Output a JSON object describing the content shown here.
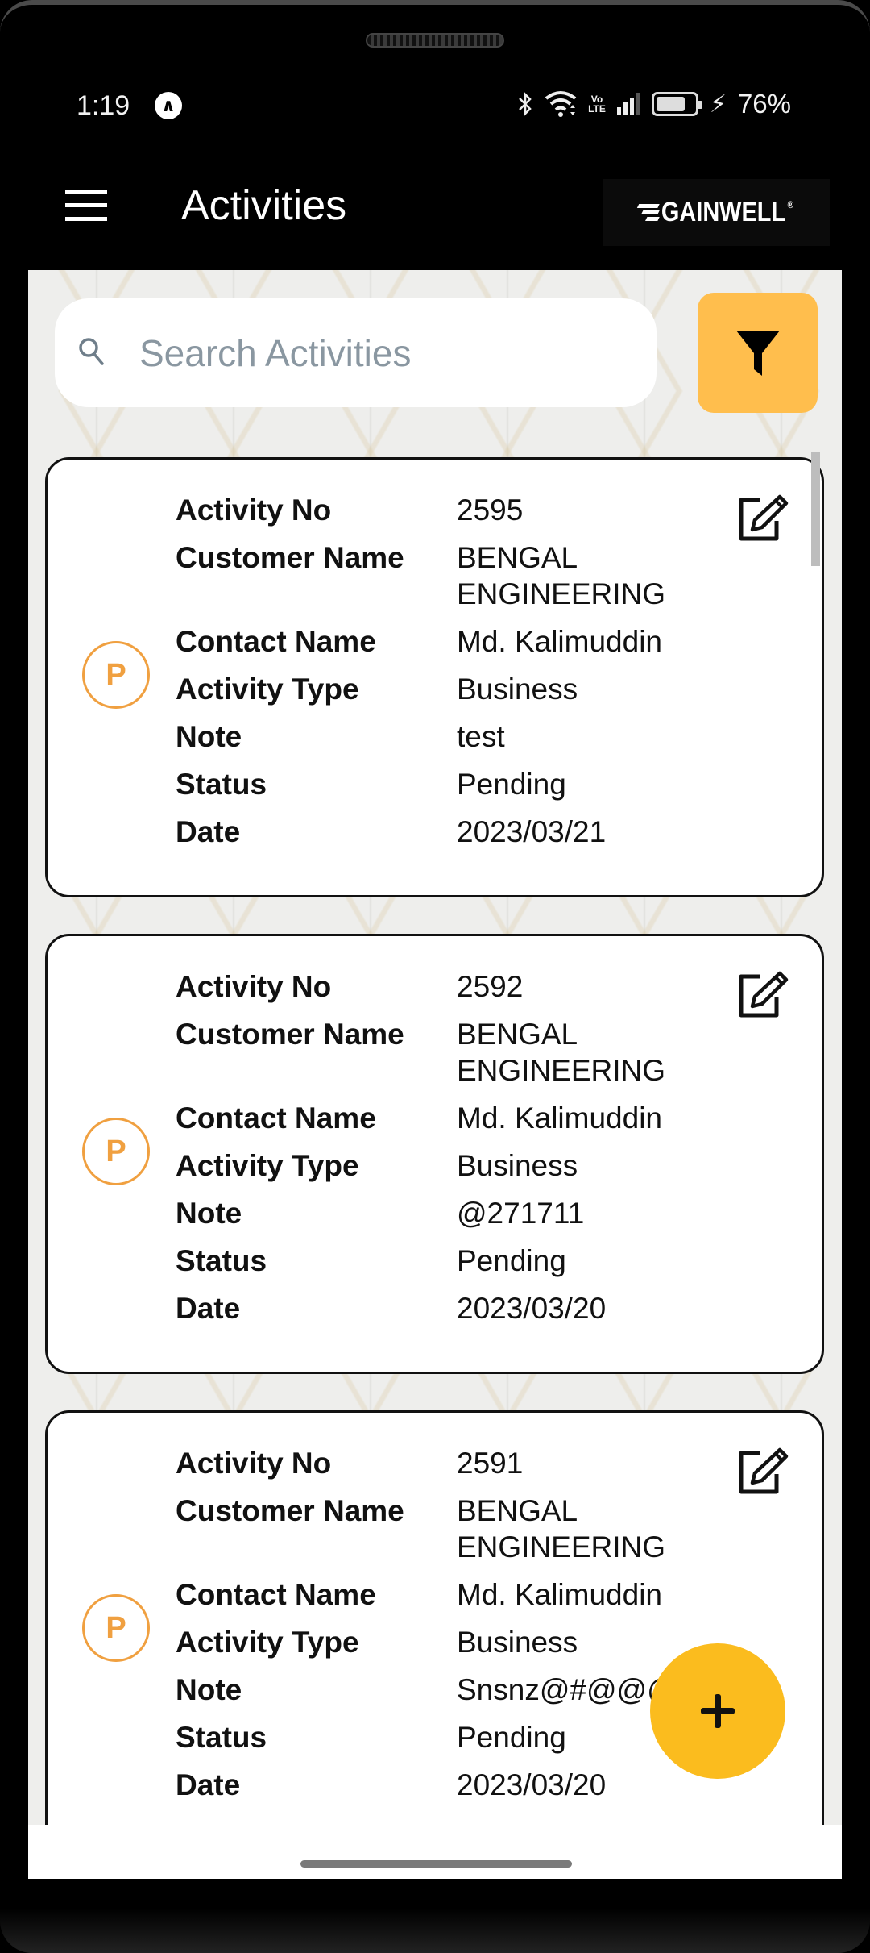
{
  "status_bar": {
    "time": "1:19",
    "notification_icon": "a-circle-icon",
    "icons": [
      "bluetooth-icon",
      "wifi-icon",
      "volte-icon",
      "signal-icon",
      "battery-icon",
      "charging-icon"
    ],
    "volte_top": "Vo",
    "volte_bottom": "LTE",
    "battery_percent_text": "76%",
    "battery_level": 0.76
  },
  "app_bar": {
    "menu_icon": "hamburger-menu-icon",
    "title": "Activities",
    "logo_text": "GAINWELL",
    "logo_reg": "®"
  },
  "search": {
    "placeholder": "Search Activities",
    "value": "",
    "icon": "search-icon"
  },
  "filter_button": {
    "icon": "filter-funnel-icon",
    "color": "#ffbe4d"
  },
  "labels": {
    "activity_no": "Activity No",
    "customer_name": "Customer Name",
    "contact_name": "Contact Name",
    "activity_type": "Activity Type",
    "note": "Note",
    "status": "Status",
    "date": "Date"
  },
  "activities": [
    {
      "avatar_letter": "P",
      "activity_no": "2595",
      "customer_name": "BENGAL ENGINEERING",
      "contact_name": "Md. Kalimuddin",
      "activity_type": "Business",
      "note": "test",
      "status": "Pending",
      "date": "2023/03/21"
    },
    {
      "avatar_letter": "P",
      "activity_no": "2592",
      "customer_name": "BENGAL ENGINEERING",
      "contact_name": "Md. Kalimuddin",
      "activity_type": "Business",
      "note": "@271711",
      "status": "Pending",
      "date": "2023/03/20"
    },
    {
      "avatar_letter": "P",
      "activity_no": "2591",
      "customer_name": "BENGAL ENGINEERING",
      "contact_name": "Md. Kalimuddin",
      "activity_type": "Business",
      "note": "Snsnz@#@@@",
      "status": "Pending",
      "date": "2023/03/20"
    }
  ],
  "fab": {
    "icon": "plus-icon",
    "color": "#fbbc1e"
  },
  "colors": {
    "avatar_accent": "#f0a040",
    "app_bar_bg": "#000000",
    "content_bg": "#eeeeec"
  }
}
